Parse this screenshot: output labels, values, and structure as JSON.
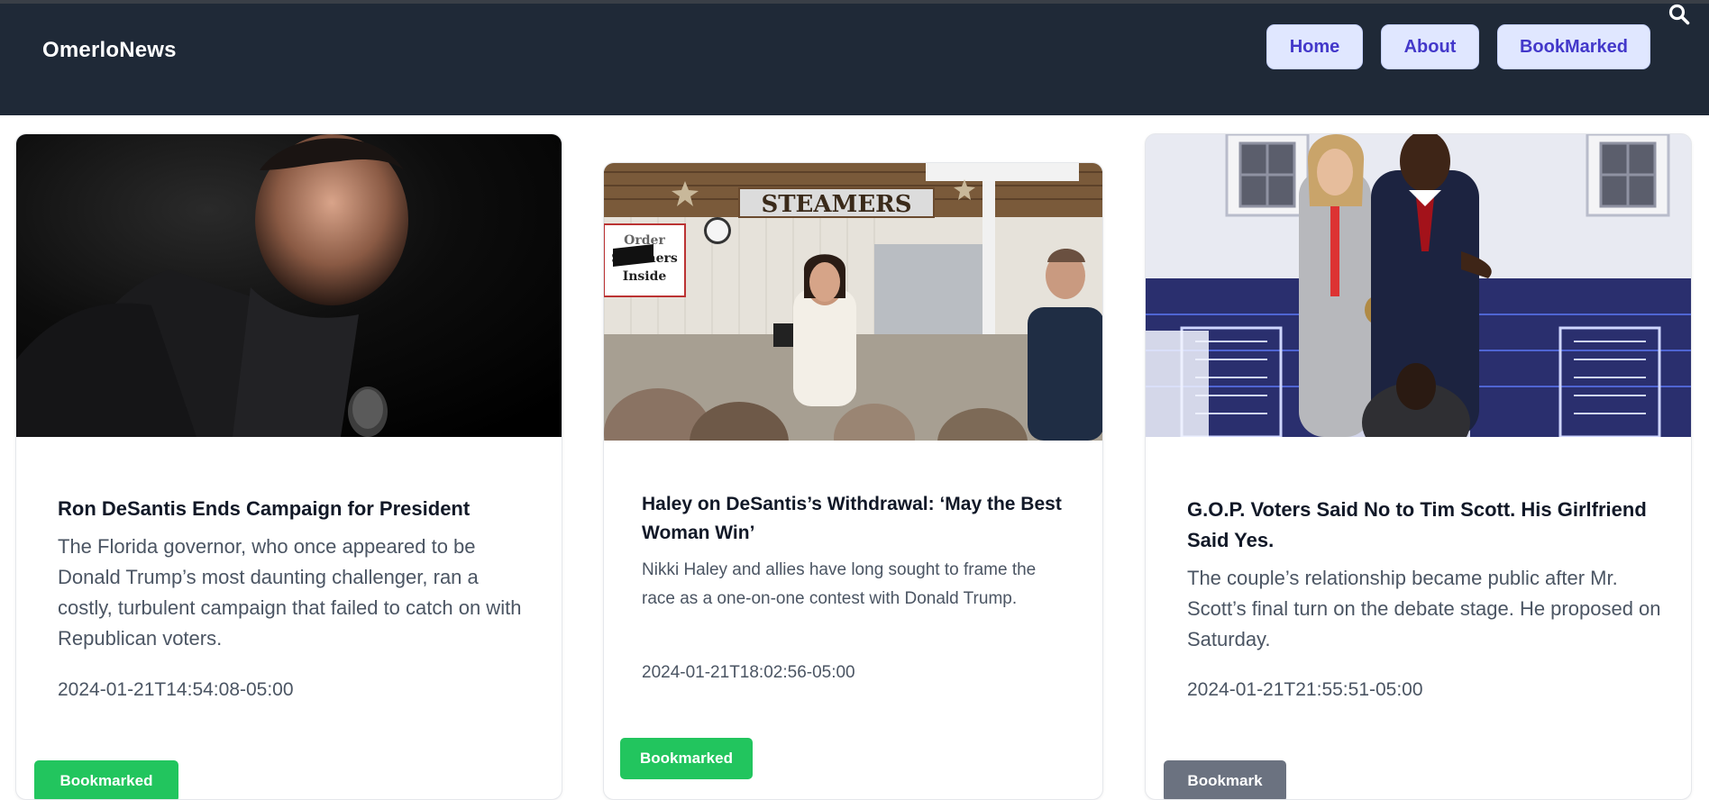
{
  "header": {
    "brand": "OmerloNews",
    "nav": [
      {
        "label": "Home"
      },
      {
        "label": "About"
      },
      {
        "label": "BookMarked"
      }
    ],
    "search_icon": "search-icon"
  },
  "articles": [
    {
      "title": "Ron DeSantis Ends Campaign for President",
      "description": "The Florida governor, who once appeared to be Donald Trump’s most daunting challenger, ran a costly, turbulent campaign that failed to catch on with Republican voters.",
      "date": "2024-01-21T14:54:08-05:00",
      "bookmark_label": "Bookmarked",
      "bookmarked": true
    },
    {
      "title": "Haley on DeSantis’s Withdrawal: ‘May the Best Woman Win’",
      "description": "Nikki Haley and allies have long sought to frame the race as a one-on-one contest with Donald Trump.",
      "date": "2024-01-21T18:02:56-05:00",
      "bookmark_label": "Bookmarked",
      "bookmarked": true,
      "image_sign": "STEAMERS",
      "image_small_sign_1": "Order",
      "image_small_sign_2": "Steamers",
      "image_small_sign_3": "Inside"
    },
    {
      "title": "G.O.P. Voters Said No to Tim Scott. His Girlfriend Said Yes.",
      "description": "The couple’s relationship became public after Mr. Scott’s final turn on the debate stage. He proposed on Saturday.",
      "date": "2024-01-21T21:55:51-05:00",
      "bookmark_label": "Bookmark",
      "bookmarked": false
    }
  ],
  "colors": {
    "navbar": "#1f2937",
    "nav_button_bg": "#e0e7ff",
    "nav_button_text": "#4338ca",
    "bookmarked_green": "#22c55e",
    "bookmark_gray": "#6b7280"
  }
}
